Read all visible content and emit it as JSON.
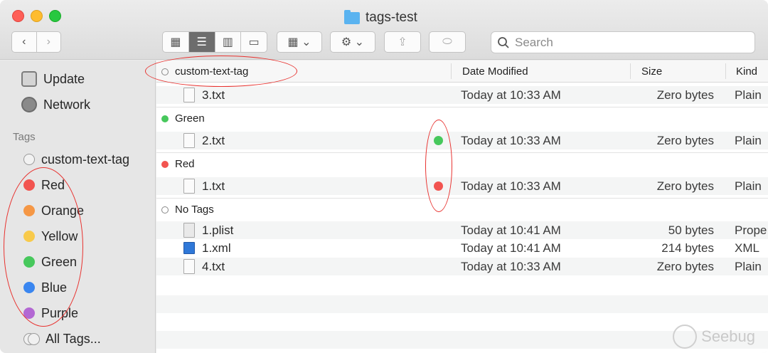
{
  "window": {
    "title": "tags-test"
  },
  "toolbar": {
    "back_label": "‹",
    "forward_label": "›",
    "views": [
      "▦",
      "☰",
      "▥",
      "▭"
    ],
    "group_label": "▦ ⌄",
    "action_label": "⚙ ⌄",
    "share_label": "⇪",
    "tag_label": "⬭",
    "search_placeholder": "Search"
  },
  "sidebar": {
    "devices": [
      {
        "label": "Update",
        "icon": "disk-icon"
      },
      {
        "label": "Network",
        "icon": "network-globe-icon"
      }
    ],
    "tags_heading": "Tags",
    "tags": [
      {
        "label": "custom-text-tag",
        "color": ""
      },
      {
        "label": "Red",
        "color": "#f25450"
      },
      {
        "label": "Orange",
        "color": "#f59745"
      },
      {
        "label": "Yellow",
        "color": "#f8ca4b"
      },
      {
        "label": "Green",
        "color": "#47c85c"
      },
      {
        "label": "Blue",
        "color": "#3a86f0"
      },
      {
        "label": "Purple",
        "color": "#b368d3"
      },
      {
        "label": "All Tags...",
        "color": ""
      }
    ]
  },
  "columns": {
    "name": "custom-text-tag",
    "date": "Date Modified",
    "size": "Size",
    "kind": "Kind"
  },
  "groups": [
    {
      "label": "custom-text-tag",
      "files": [
        {
          "name": "3.txt",
          "date": "Today at 10:33 AM",
          "size": "Zero bytes",
          "kind": "Plain"
        }
      ]
    },
    {
      "label": "Green",
      "color": "#47c85c",
      "files": [
        {
          "name": "2.txt",
          "date": "Today at 10:33 AM",
          "size": "Zero bytes",
          "kind": "Plain",
          "tag_color": "#47c85c"
        }
      ]
    },
    {
      "label": "Red",
      "color": "#f25450",
      "files": [
        {
          "name": "1.txt",
          "date": "Today at 10:33 AM",
          "size": "Zero bytes",
          "kind": "Plain",
          "tag_color": "#f25450"
        }
      ]
    },
    {
      "label": "No Tags",
      "files": [
        {
          "name": "1.plist",
          "date": "Today at 10:41 AM",
          "size": "50 bytes",
          "kind": "Prope"
        },
        {
          "name": "1.xml",
          "date": "Today at 10:41 AM",
          "size": "214 bytes",
          "kind": "XML"
        },
        {
          "name": "4.txt",
          "date": "Today at 10:33 AM",
          "size": "Zero bytes",
          "kind": "Plain"
        }
      ]
    }
  ],
  "watermark": {
    "text": "Seebug"
  },
  "colors": {
    "annotation": "#e8322f",
    "selected_view": "#6d6d6d"
  }
}
